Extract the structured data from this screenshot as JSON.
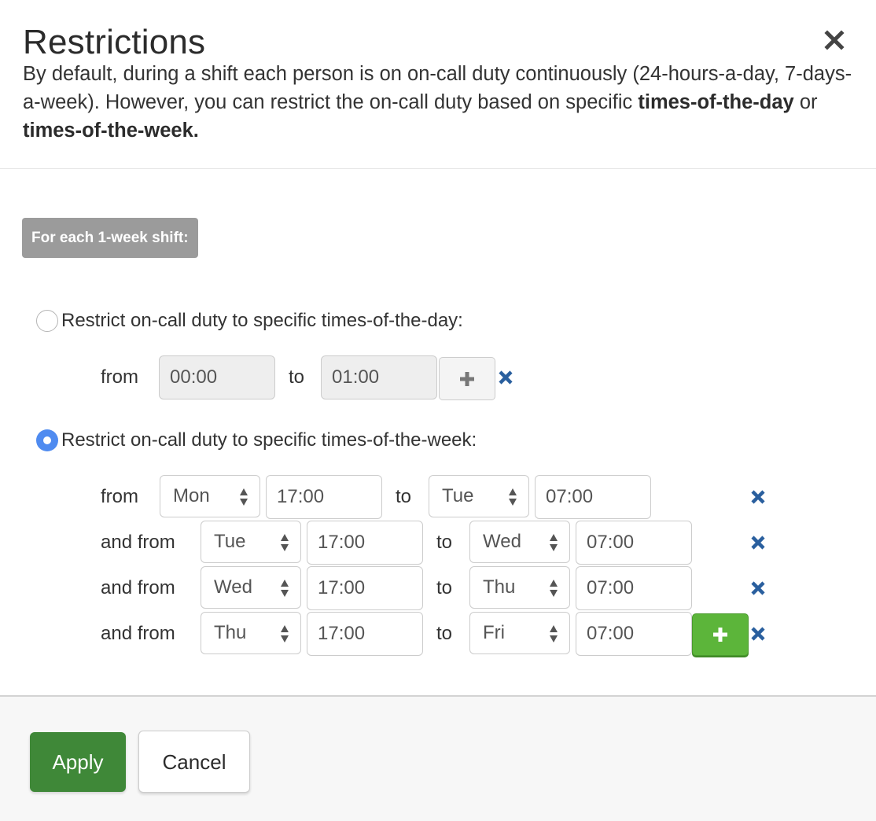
{
  "dialog": {
    "title": "Restrictions",
    "close_icon": "close-icon",
    "description": {
      "text_before": "By default, during a shift each person is on on-call duty continuously (24-hours-a-day, 7-days-a-week). However, you can restrict the on-call duty based on specific ",
      "bold_1": "times-of-the-day",
      "text_middle": " or ",
      "bold_2": "times-of-the-week."
    }
  },
  "shift_badge": "For each 1-week shift:",
  "day_option": {
    "label": "Restrict on-call duty to specific times-of-the-day:",
    "selected": false,
    "from_label": "from",
    "from_value": "00:00",
    "to_label": "to",
    "to_value": "01:00",
    "disabled": true
  },
  "week_option": {
    "label": "Restrict on-call duty to specific times-of-the-week:",
    "selected": true,
    "rows": [
      {
        "prefix": "from",
        "from_day": "Mon",
        "from_time": "17:00",
        "to_label": "to",
        "to_day": "Tue",
        "to_time": "07:00"
      },
      {
        "prefix": "and from",
        "from_day": "Tue",
        "from_time": "17:00",
        "to_label": "to",
        "to_day": "Wed",
        "to_time": "07:00"
      },
      {
        "prefix": "and from",
        "from_day": "Wed",
        "from_time": "17:00",
        "to_label": "to",
        "to_day": "Thu",
        "to_time": "07:00"
      },
      {
        "prefix": "and from",
        "from_day": "Thu",
        "from_time": "17:00",
        "to_label": "to",
        "to_day": "Fri",
        "to_time": "07:00"
      }
    ]
  },
  "footer": {
    "apply_label": "Apply",
    "cancel_label": "Cancel"
  },
  "colors": {
    "apply": "#3f8838",
    "add_green": "#5cb53a",
    "remove_blue": "#2a5f9e",
    "radio_selected": "#4f8bf0",
    "badge": "#9b9b9b"
  }
}
